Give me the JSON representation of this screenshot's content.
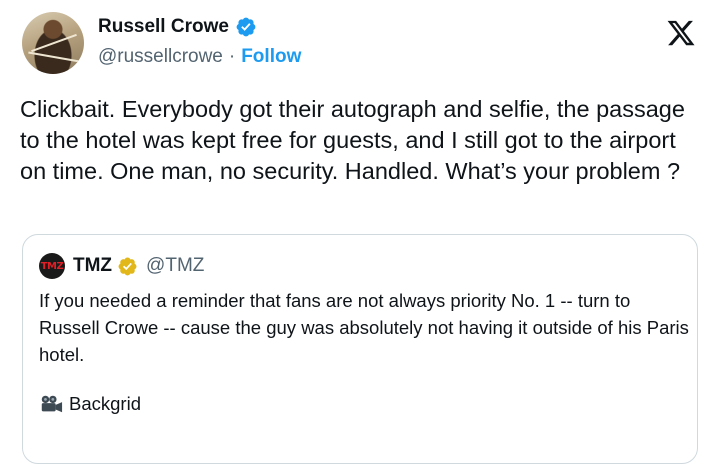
{
  "author": {
    "name": "Russell Crowe",
    "handle": "@russellcrowe",
    "separator": "·",
    "follow_label": "Follow"
  },
  "tweet": {
    "text": "Clickbait. Everybody got their autograph and selfie, the passage to the hotel was kept free for guests, and I still got to the airport on time. One man, no security. Handled. What’s your problem ?"
  },
  "quote": {
    "avatar_text": "TMZ",
    "name": "TMZ",
    "handle": "@TMZ",
    "text": "If you needed a reminder that fans are not always priority No. 1 -- turn to Russell Crowe -- cause the guy was absolutely not having it outside of his Paris hotel.",
    "credit": "Backgrid"
  },
  "icons": {
    "verified": "blue-verified-badge-icon",
    "gold_verified": "gold-verified-badge-icon",
    "logo": "x-logo-icon",
    "camera": "movie-camera-icon"
  },
  "colors": {
    "link": "#1d9bf0",
    "muted": "#536471",
    "text": "#0f1419",
    "border": "#cfd9de",
    "gold": "#e2b719"
  }
}
